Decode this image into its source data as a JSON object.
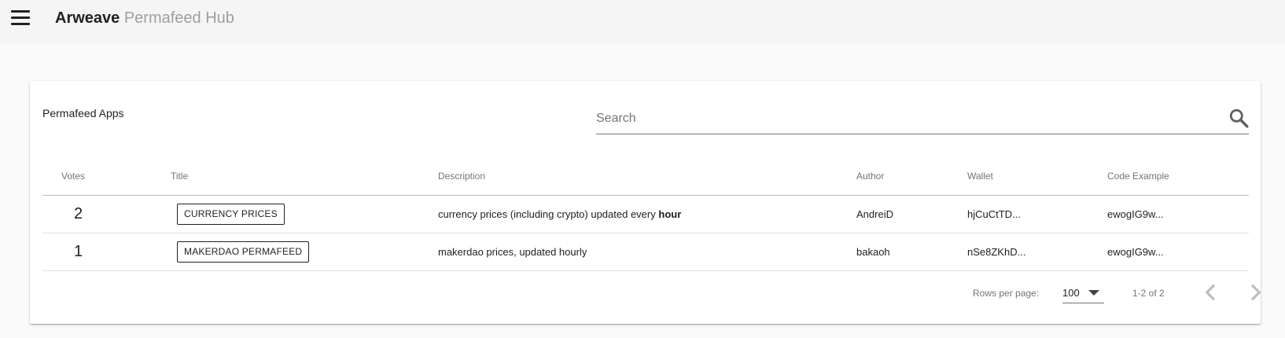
{
  "appbar": {
    "brand_primary": "Arweave",
    "brand_secondary": "Permafeed Hub"
  },
  "card": {
    "title": "Permafeed Apps"
  },
  "search": {
    "placeholder": "Search",
    "value": ""
  },
  "table": {
    "columns": [
      "Votes",
      "Title",
      "Description",
      "Author",
      "Wallet",
      "Code Example"
    ],
    "rows": [
      {
        "votes": "2",
        "title": "CURRENCY PRICES",
        "description": "currency prices (including crypto) updated every",
        "description_bold": "hour",
        "author": "AndreiD",
        "wallet": "hjCuCtTD...",
        "code": "ewogIG9w..."
      },
      {
        "votes": "1",
        "title": "MAKERDAO PERMAFEED",
        "description": "makerdao prices, updated hourly",
        "description_bold": "",
        "author": "bakaoh",
        "wallet": "nSe8ZKhD...",
        "code": "ewogIG9w..."
      }
    ]
  },
  "pagination": {
    "rows_per_page_label": "Rows per page:",
    "rows_per_page_value": "100",
    "range": "1-2 of 2"
  },
  "icons": {
    "menu": "hamburger-menu-icon",
    "search": "search-icon",
    "dropdown": "caret-down-icon",
    "prev": "chevron-left-icon",
    "next": "chevron-right-icon"
  },
  "colors": {
    "appbar_bg": "#f5f5f5",
    "page_bg": "#fafafa",
    "text": "#212121",
    "muted": "#757575",
    "brand_secondary": "#9e9e9e"
  }
}
